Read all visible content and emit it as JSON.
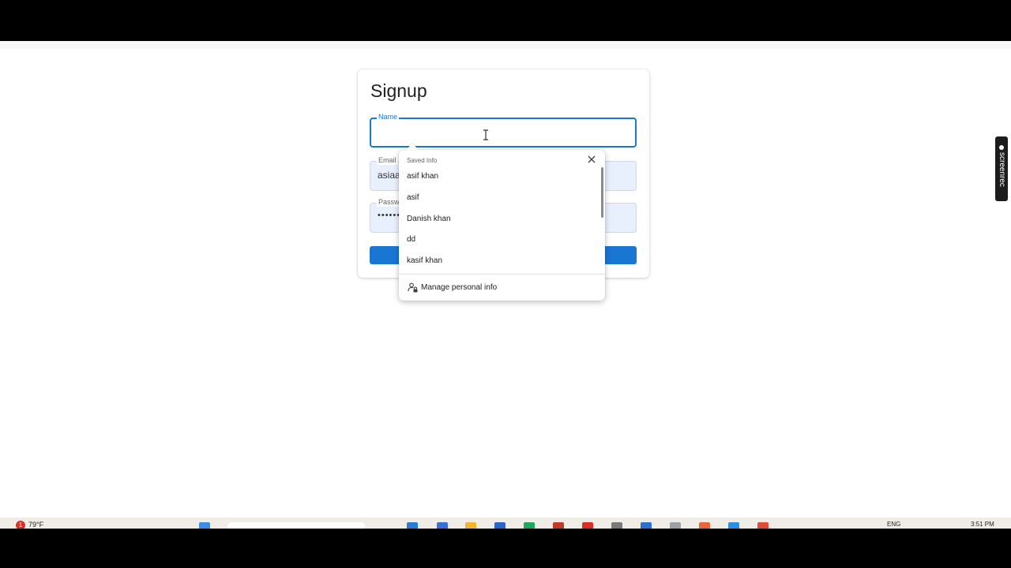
{
  "signup": {
    "title": "Signup",
    "name_label": "Name",
    "name_value": "",
    "email_label": "Email",
    "email_value": "asiaa",
    "password_label": "Password",
    "password_value": "•••••••••"
  },
  "autofill": {
    "header": "Saved Info",
    "suggestions": [
      "asif khan",
      "asif",
      "Danish khan",
      "dd",
      "kasif khan"
    ],
    "manage_label": "Manage personal info"
  },
  "overlay": {
    "screenrec_label": "screenrec"
  },
  "taskbar": {
    "weather_badge": "1",
    "weather": "79°F",
    "language": "ENG",
    "clock": "3:51 PM"
  },
  "colors": {
    "primary": "#1976d2",
    "autofill_bg": "#e8f0fe"
  },
  "icons": {
    "close": "close-icon",
    "manage": "person-lock-icon",
    "text_cursor": "text-cursor-icon"
  }
}
